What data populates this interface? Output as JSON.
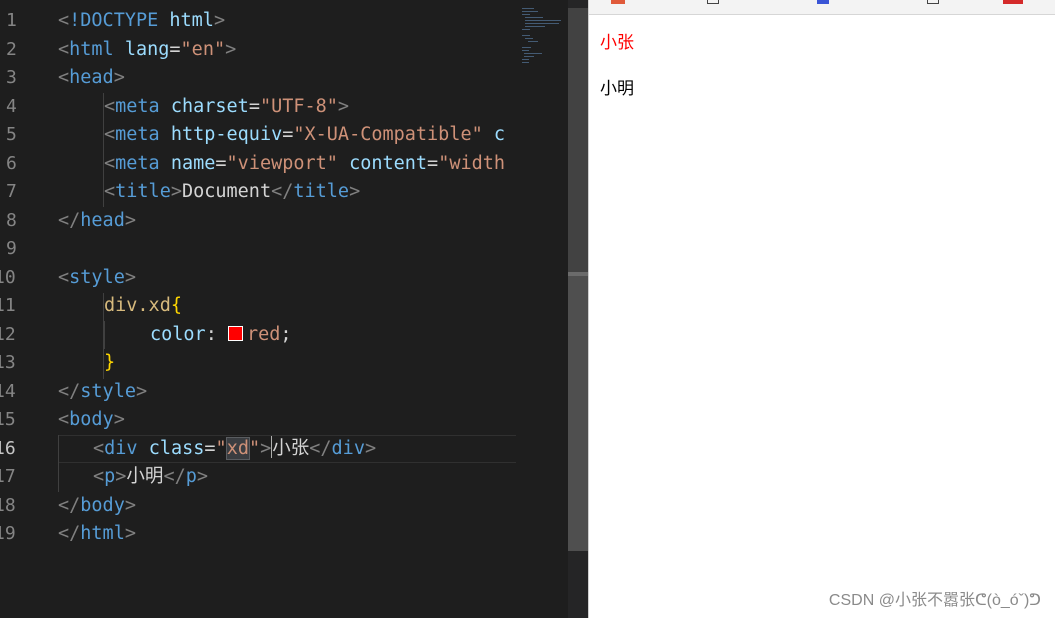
{
  "editor": {
    "line_numbers": [
      "1",
      "2",
      "3",
      "4",
      "5",
      "6",
      "7",
      "8",
      "9",
      "10",
      "11",
      "12",
      "13",
      "14",
      "15",
      "16",
      "17",
      "18",
      "19"
    ],
    "line1": {
      "doctype": "!DOCTYPE",
      "html": "html"
    },
    "line2": {
      "tag": "html",
      "attr": "lang",
      "value": "\"en\""
    },
    "line3": {
      "tag": "head"
    },
    "line4": {
      "tag": "meta",
      "attr": "charset",
      "value": "\"UTF-8\""
    },
    "line5": {
      "tag": "meta",
      "attr": "http-equiv",
      "value": "\"X-UA-Compatible\"",
      "attr2": "c"
    },
    "line6": {
      "tag": "meta",
      "attr": "name",
      "value": "\"viewport\"",
      "attr2": "content",
      "value2": "\"width"
    },
    "line7": {
      "tag": "title",
      "text": "Document"
    },
    "line8": {
      "tag": "head"
    },
    "line10": {
      "tag": "style"
    },
    "line11": {
      "selector": "div.xd",
      "brace": "{"
    },
    "line12": {
      "property": "color",
      "colon": ":",
      "value": "red",
      "semi": ";",
      "swatch_color": "#ff0000"
    },
    "line13": {
      "brace": "}"
    },
    "line14": {
      "tag": "style"
    },
    "line15": {
      "tag": "body"
    },
    "line16": {
      "tag": "div",
      "attr": "class",
      "value_inner": "xd",
      "text": "小张"
    },
    "line17": {
      "tag": "p",
      "text": "小明"
    },
    "line18": {
      "tag": "body"
    },
    "line19": {
      "tag": "html"
    }
  },
  "preview": {
    "div_text": "小张",
    "div_color": "#ff0000",
    "p_text": "小明"
  },
  "watermark": "CSDN @小张不嚣张ᕦ(ò_óˇ)ᕤ"
}
